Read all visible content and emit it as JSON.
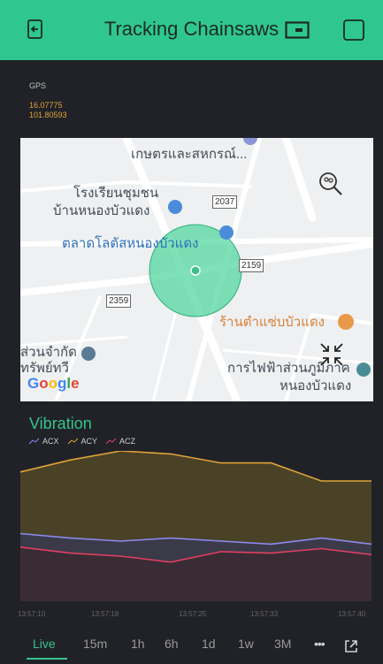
{
  "header": {
    "title": "Tracking Chainsaws",
    "left_icon": "exit-icon",
    "right_icons": [
      "device-icon",
      "square-icon"
    ],
    "background": "#2fc78f"
  },
  "gps": {
    "label": "GPS",
    "lat": "16.07775",
    "lon": "101.80593"
  },
  "map": {
    "labels": {
      "top_bank": "เกษตรและสหกรณ์...",
      "school_1": "โรงเรียนชุมชน",
      "school_2": "บ้านหนองบัวแดง",
      "market": "ตลาดโลตัสหนองบัวแดง",
      "restaurant": "ร้านตำแซ่บบัวแดง",
      "company_1": "ส่วนจำกัด",
      "company_2": "ทรัพย์ทวี",
      "electric_1": "การไฟฟ้าส่วนภูมิภาค",
      "electric_2": "หนองบัวแดง"
    },
    "road_numbers": [
      "2037",
      "2159",
      "2359"
    ],
    "google": "Google"
  },
  "chart_data": {
    "type": "area",
    "title": "Vibration",
    "x": [
      "13:57:10",
      "13:57:18",
      "13:57:25",
      "13:57:33",
      "13:57:40"
    ],
    "series": [
      {
        "name": "ACX",
        "color": "#8a8af0",
        "values": [
          0.45,
          0.42,
          0.4,
          0.42,
          0.4,
          0.38,
          0.42,
          0.38
        ]
      },
      {
        "name": "ACY",
        "color": "#e0a23a",
        "values": [
          0.86,
          0.94,
          1.0,
          0.98,
          0.92,
          0.92,
          0.8,
          0.8
        ]
      },
      {
        "name": "ACZ",
        "color": "#e04060",
        "values": [
          0.36,
          0.32,
          0.3,
          0.26,
          0.33,
          0.32,
          0.35,
          0.31
        ]
      }
    ],
    "legend": "top-left"
  },
  "tabs": {
    "items": [
      "Live",
      "15m",
      "1h",
      "6h",
      "1d",
      "1w",
      "3M"
    ],
    "active": "Live",
    "more": "•••"
  }
}
